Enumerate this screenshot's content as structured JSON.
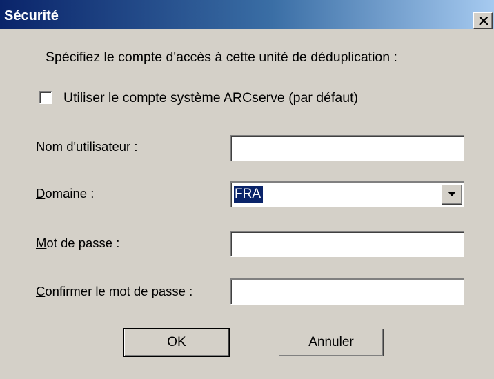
{
  "window": {
    "title": "Sécurité"
  },
  "instruction": "Spécifiez le compte d'accès à cette unité de déduplication :",
  "checkbox": {
    "checked": false,
    "label_pre": "Utiliser le compte système ",
    "label_mnemonic": "A",
    "label_post": "RCserve (par défaut)"
  },
  "fields": {
    "username": {
      "label_pre": "Nom d'",
      "label_mnemonic": "u",
      "label_post": "tilisateur :",
      "value": ""
    },
    "domain": {
      "label_pre": "",
      "label_mnemonic": "D",
      "label_post": "omaine :",
      "value": "FRA"
    },
    "password": {
      "label_pre": "",
      "label_mnemonic": "M",
      "label_post": "ot de passe :",
      "value": ""
    },
    "confirm": {
      "label_pre": "",
      "label_mnemonic": "C",
      "label_post": "onfirmer le mot de passe :",
      "value": ""
    }
  },
  "buttons": {
    "ok": "OK",
    "cancel": "Annuler"
  },
  "colors": {
    "title_gradient_start": "#0a246a",
    "title_gradient_end": "#a6caf0",
    "dialog_background": "#d4d0c8",
    "selection": "#0a246a"
  }
}
